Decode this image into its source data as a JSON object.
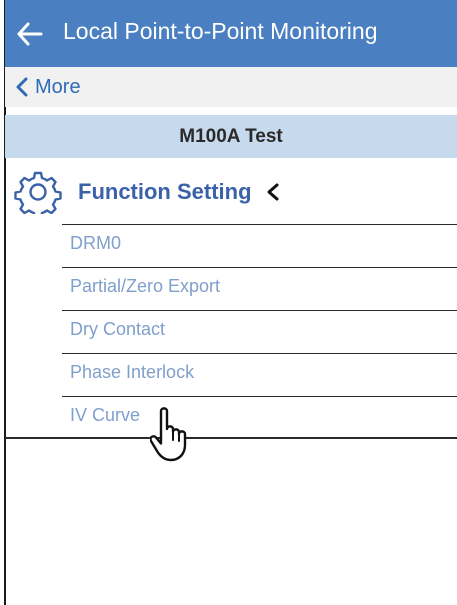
{
  "header": {
    "title": "Local Point-to-Point Monitoring",
    "back_icon": "arrow-left-icon"
  },
  "subnav": {
    "more_label": "More",
    "more_icon": "chevron-left-icon"
  },
  "device": {
    "name": "M100A Test"
  },
  "section": {
    "title": "Function Setting",
    "icon": "gear-icon",
    "toggle_icon": "chevron-left-icon"
  },
  "menu": {
    "items": [
      {
        "label": "DRM0"
      },
      {
        "label": "Partial/Zero Export"
      },
      {
        "label": "Dry Contact"
      },
      {
        "label": "Phase Interlock"
      },
      {
        "label": "IV Curve"
      }
    ]
  },
  "colors": {
    "header_bg": "#4a7fc1",
    "device_bar_bg": "#c7d9ec",
    "accent": "#3b62a8",
    "menu_text": "#7f9fcc"
  },
  "cursor_icon": "hand-pointer-icon"
}
